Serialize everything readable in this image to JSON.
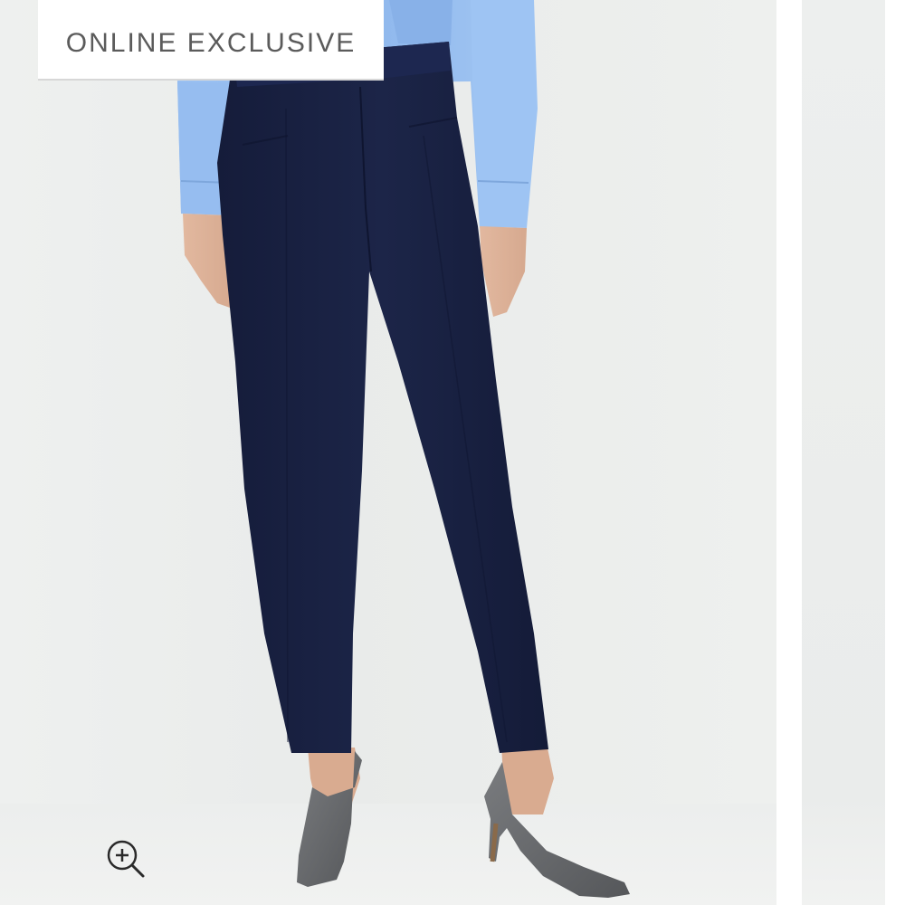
{
  "badge": {
    "label": "ONLINE EXCLUSIVE"
  },
  "zoom_button": {
    "icon": "zoom-in-icon"
  },
  "colors": {
    "background": "#eceeed",
    "shirt": "#8fb8ee",
    "pants": "#1a2346",
    "shoes": "#6a6c6f",
    "badge_text": "#5b5b5b"
  }
}
